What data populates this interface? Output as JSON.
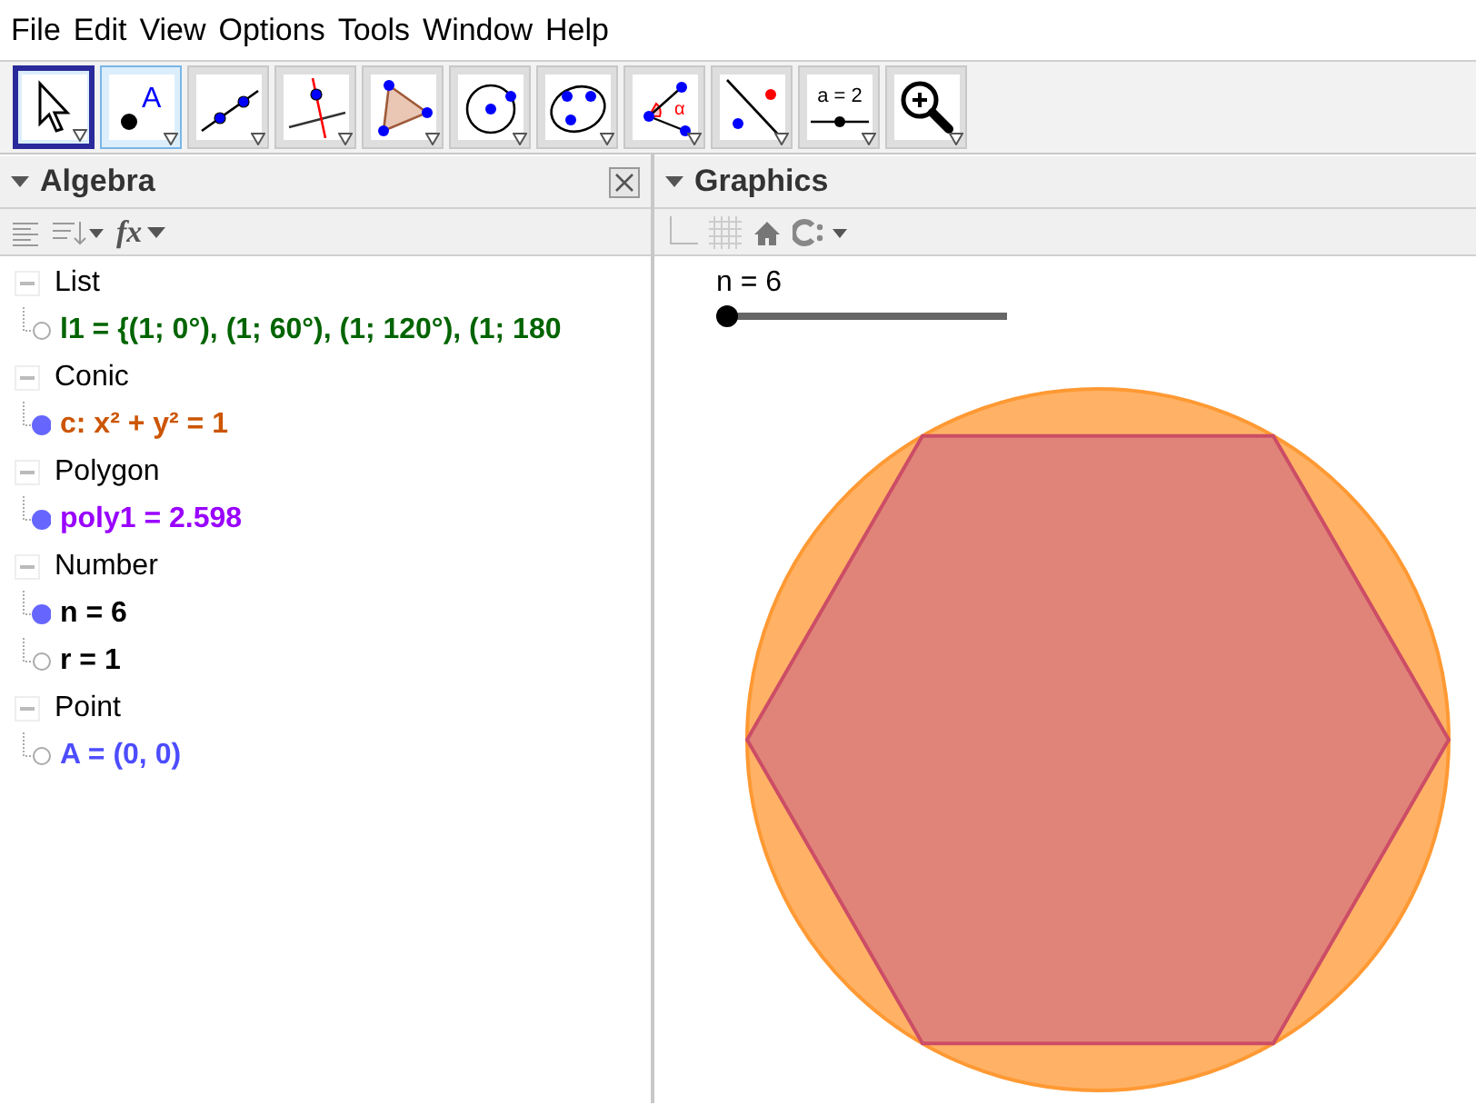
{
  "menu": [
    "File",
    "Edit",
    "View",
    "Options",
    "Tools",
    "Window",
    "Help"
  ],
  "toolbar": [
    {
      "kind": "move",
      "selected": true,
      "highlighted": false
    },
    {
      "kind": "point",
      "selected": false,
      "highlighted": true,
      "label": "A"
    },
    {
      "kind": "line",
      "selected": false,
      "highlighted": false
    },
    {
      "kind": "perpendicular",
      "selected": false,
      "highlighted": false
    },
    {
      "kind": "polygon",
      "selected": false,
      "highlighted": false
    },
    {
      "kind": "circle",
      "selected": false,
      "highlighted": false
    },
    {
      "kind": "conic",
      "selected": false,
      "highlighted": false
    },
    {
      "kind": "angle",
      "selected": false,
      "highlighted": false,
      "label": "α"
    },
    {
      "kind": "reflect",
      "selected": false,
      "highlighted": false
    },
    {
      "kind": "slider",
      "selected": false,
      "highlighted": false,
      "label": "a = 2"
    },
    {
      "kind": "zoom",
      "selected": false,
      "highlighted": false
    }
  ],
  "algebra": {
    "title": "Algebra",
    "fx_label": "fx",
    "groups": [
      {
        "label": "List",
        "children": [
          {
            "text": "l1 = {(1; 0°), (1; 60°), (1; 120°), (1; 180",
            "color": "#006400",
            "visible": false
          }
        ]
      },
      {
        "label": "Conic",
        "children": [
          {
            "text": "c: x² + y² = 1",
            "color": "#cc5500",
            "visible": true
          }
        ]
      },
      {
        "label": "Polygon",
        "children": [
          {
            "text": "poly1 = 2.598",
            "color": "#9900ff",
            "visible": true
          }
        ]
      },
      {
        "label": "Number",
        "children": [
          {
            "text": "n = 6",
            "color": "#000000",
            "visible": true
          },
          {
            "text": "r = 1",
            "color": "#000000",
            "visible": false
          }
        ]
      },
      {
        "label": "Point",
        "children": [
          {
            "text": "A = (0, 0)",
            "color": "#4d4dff",
            "visible": false
          }
        ]
      }
    ]
  },
  "graphics": {
    "title": "Graphics",
    "slider": {
      "label": "n = 6",
      "level": 0
    }
  }
}
